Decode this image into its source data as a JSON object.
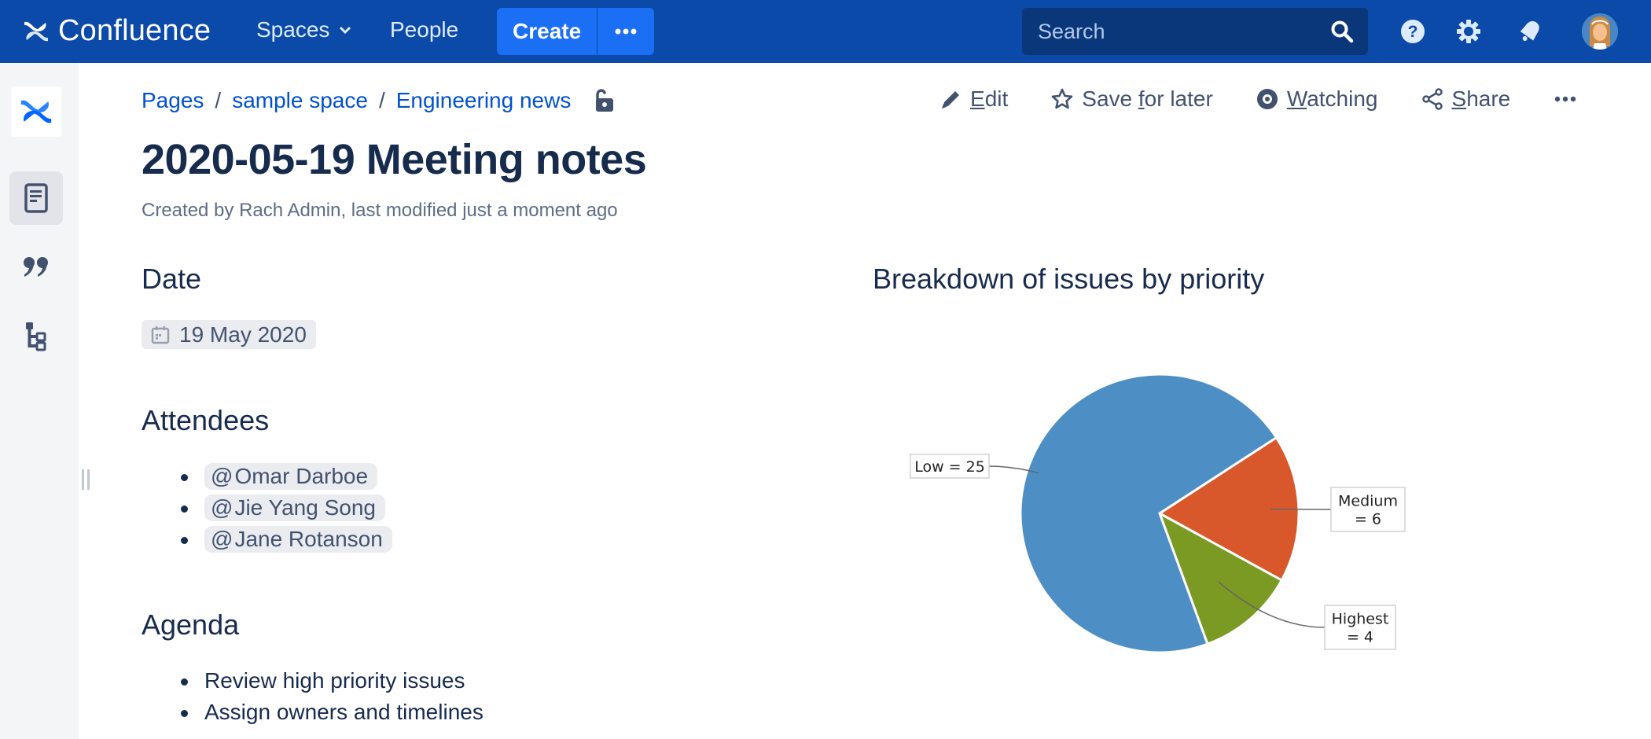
{
  "topnav": {
    "brand": "Confluence",
    "spaces_label": "Spaces",
    "people_label": "People",
    "create_label": "Create",
    "more_label": "•••",
    "search_placeholder": "Search",
    "icons": [
      "help-icon",
      "settings-icon",
      "notifications-icon"
    ],
    "avatar_alt": "User avatar"
  },
  "sidebar": {
    "items": [
      {
        "name": "pages",
        "icon": "page-icon",
        "active": true
      },
      {
        "name": "blog",
        "icon": "quote-icon",
        "active": false
      },
      {
        "name": "page-tree",
        "icon": "hierarchy-icon",
        "active": false
      }
    ]
  },
  "breadcrumbs": [
    {
      "label": "Pages"
    },
    {
      "label": "sample space"
    },
    {
      "label": "Engineering news"
    }
  ],
  "breadcrumb_separator": "/",
  "actions": {
    "edit": {
      "prefix": "",
      "underlined": "E",
      "suffix": "dit"
    },
    "save": {
      "prefix": "Save ",
      "underlined": "f",
      "suffix": "or later"
    },
    "watch": {
      "prefix": "",
      "underlined": "W",
      "suffix": "atching"
    },
    "share": {
      "prefix": "",
      "underlined": "S",
      "suffix": "hare"
    },
    "more": "•••"
  },
  "page": {
    "title": "2020-05-19 Meeting notes",
    "byline": "Created by Rach Admin, last modified just a moment ago",
    "date_heading": "Date",
    "date_value": "19 May 2020",
    "attendees_heading": "Attendees",
    "attendees": [
      {
        "at": "@",
        "name": "Omar Darboe"
      },
      {
        "at": "@",
        "name": "Jie Yang Song"
      },
      {
        "at": "@",
        "name": "Jane Rotanson"
      }
    ],
    "agenda_heading": "Agenda",
    "agenda": [
      "Review high priority issues",
      "Assign owners and timelines"
    ],
    "chart_heading": "Breakdown of issues by priority"
  },
  "chart_data": {
    "type": "pie",
    "title": "Breakdown of issues by priority",
    "slices": [
      {
        "label": "Medium",
        "value": 6,
        "color": "#d9582b",
        "display": [
          "Medium",
          "= 6"
        ]
      },
      {
        "label": "Highest",
        "value": 4,
        "color": "#7a9a23",
        "display": [
          "Highest",
          "= 4"
        ]
      },
      {
        "label": "Low",
        "value": 25,
        "color": "#4d8fc5",
        "display": [
          "Low = 25"
        ]
      }
    ],
    "legend": "none",
    "labels": "callout"
  }
}
